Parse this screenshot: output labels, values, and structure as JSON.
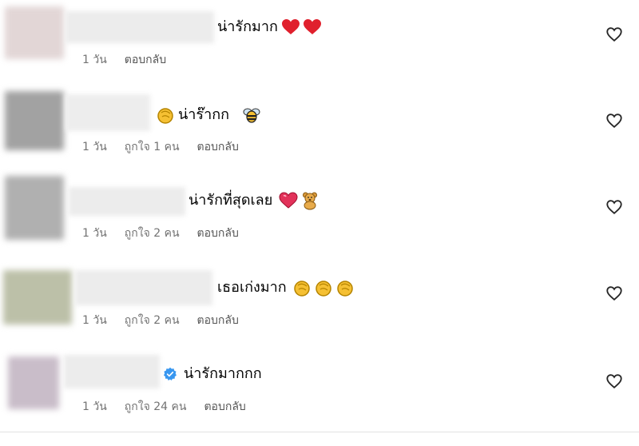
{
  "comments": [
    {
      "text": "น่ารักมาก",
      "emojis": [
        "red-heart",
        "red-heart"
      ],
      "time": "1 วัน",
      "likes": "",
      "reply": "ตอบกลับ",
      "verified": false,
      "avatar_color": "#d9c9c9"
    },
    {
      "text": "น่าร๊ากก",
      "emojis_before": [
        "clapping-hands"
      ],
      "emojis": [
        "bee"
      ],
      "time": "1 วัน",
      "likes": "ถูกใจ 1 คน",
      "reply": "ตอบกลับ",
      "verified": false,
      "avatar_color": "#9b9b9b"
    },
    {
      "text": "น่ารักที่สุดเลย",
      "emojis": [
        "heart-with-ribbon",
        "teddy-bear"
      ],
      "time": "1 วัน",
      "likes": "ถูกใจ 2 คน",
      "reply": "ตอบกลับ",
      "verified": false,
      "avatar_color": "#a8a8a8"
    },
    {
      "text": "เธอเก่งมาก",
      "emojis": [
        "clapping-hands",
        "clapping-hands",
        "clapping-hands"
      ],
      "time": "1 วัน",
      "likes": "ถูกใจ 2 คน",
      "reply": "ตอบกลับ",
      "verified": false,
      "avatar_color": "#b9bda3"
    },
    {
      "text": "น่ารักมากกก",
      "emojis": [],
      "time": "1 วัน",
      "likes": "ถูกใจ 24 คน",
      "reply": "ตอบกลับ",
      "verified": true,
      "avatar_color": "#c4b8c4"
    }
  ],
  "colors": {
    "meta_text": "#737373",
    "verified_badge": "#3897f0",
    "heart_red": "#e0202d",
    "clap_yellow": "#f5c033"
  },
  "icons": {
    "like": "heart-outline-icon",
    "verified": "verified-badge-icon"
  }
}
